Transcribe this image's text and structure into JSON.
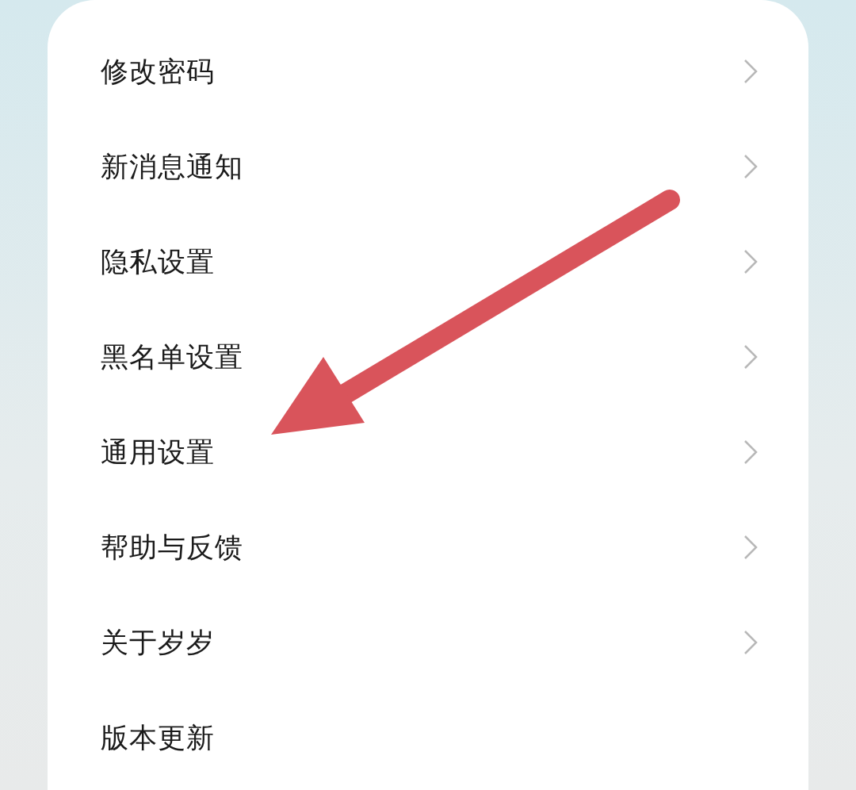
{
  "settings_items": [
    {
      "label": "修改密码",
      "chevron": true
    },
    {
      "label": "新消息通知",
      "chevron": true
    },
    {
      "label": "隐私设置",
      "chevron": true
    },
    {
      "label": "黑名单设置",
      "chevron": true
    },
    {
      "label": "通用设置",
      "chevron": true
    },
    {
      "label": "帮助与反馈",
      "chevron": true
    },
    {
      "label": "关于岁岁",
      "chevron": true
    },
    {
      "label": "版本更新",
      "chevron": false
    }
  ]
}
